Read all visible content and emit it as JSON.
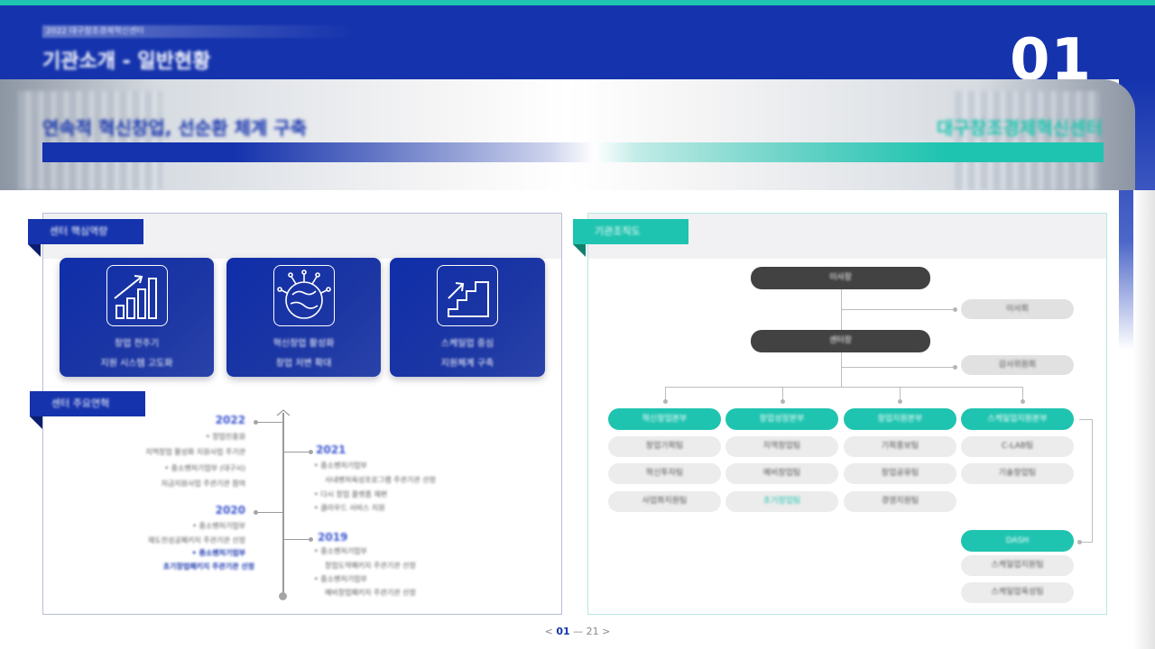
{
  "header": {
    "crumb": "2022 대구창조경제혁신센터",
    "title": "기관소개 - 일반현황",
    "page_number": "01"
  },
  "banner": {
    "headline": "연속적 혁신창업, 선순환 체계 구축",
    "organization": "대구창조경제혁신센터"
  },
  "left_panel": {
    "tag": "센터 핵심역량",
    "cards": [
      {
        "icon": "growth-chart-icon",
        "line1": "창업 전주기",
        "line2": "지원 시스템 고도화"
      },
      {
        "icon": "innovation-brain-icon",
        "line1": "혁신창업 활성화",
        "line2": "창업 저변 확대"
      },
      {
        "icon": "stairs-growth-icon",
        "line1": "스케일업 중심",
        "line2": "지원체계 구축"
      }
    ],
    "history_tag": "센터 주요연혁",
    "timeline": {
      "y2022": {
        "year": "2022",
        "items": [
          "• 창업진흥원",
          "지역창업 활성화 지원사업 주기관",
          "• 중소벤처기업부 (대구시)",
          "자금지원사업 주관기관 참여"
        ]
      },
      "y2021": {
        "year": "2021",
        "items": [
          "• 중소벤처기업부",
          "사내벤처육성프로그램 주관기관 선정",
          "• 다시 창업 플랫폼 재편",
          "• 클라우드 서비스 지원"
        ]
      },
      "y2020": {
        "year": "2020",
        "items": [
          "• 중소벤처기업부",
          "재도전성공패키지 주관기관 선정",
          "• 중소벤처기업부",
          "초기창업패키지 주관기관 선정"
        ]
      },
      "y2019": {
        "year": "2019",
        "items": [
          "• 중소벤처기업부",
          "창업도약패키지 주관기관 선정",
          "• 중소벤처기업부",
          "예비창업패키지 주관기관 선정"
        ]
      }
    }
  },
  "right_panel": {
    "tag": "기관조직도",
    "board": "이사장",
    "board_side": "이사회",
    "director": "센터장",
    "director_side": "감사위원회",
    "divisions": [
      {
        "name": "혁신창업본부",
        "teams": [
          "창업기획팀",
          "혁신투자팀",
          "사업화지원팀"
        ]
      },
      {
        "name": "창업성장본부",
        "teams": [
          "지역창업팀",
          "예비창업팀",
          "초기창업팀"
        ]
      },
      {
        "name": "창업지원본부",
        "teams": [
          "기획홍보팀",
          "창업공유팀",
          "경영지원팀"
        ]
      },
      {
        "name": "스케일업지원본부",
        "teams": [
          "C-LAB팀",
          "기술창업팀"
        ]
      }
    ],
    "highlight_team": "초기창업팀",
    "dash": {
      "name": "DASH",
      "teams": [
        "스케일업지원팀",
        "스케일업육성팀"
      ]
    }
  },
  "pager": {
    "prev": "<",
    "current": "01",
    "sep": "—",
    "total": "21",
    "next": ">"
  },
  "colors": {
    "brand_blue": "#1533ad",
    "brand_teal": "#1fc4b0",
    "dark_pill": "#424242"
  }
}
